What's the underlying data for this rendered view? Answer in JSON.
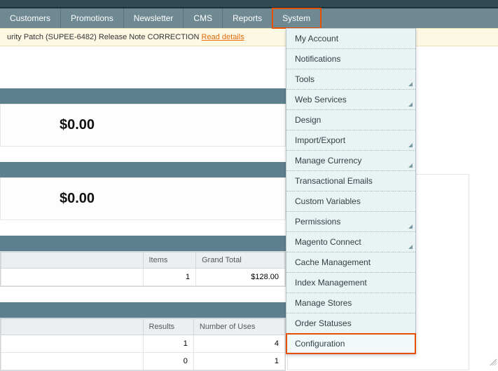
{
  "menubar": {
    "items": [
      {
        "label": "Customers"
      },
      {
        "label": "Promotions"
      },
      {
        "label": "Newsletter"
      },
      {
        "label": "CMS"
      },
      {
        "label": "Reports"
      },
      {
        "label": "System"
      }
    ]
  },
  "notice": {
    "text": "urity Patch (SUPEE-6482) Release Note CORRECTION ",
    "link": "Read details"
  },
  "dashboard": {
    "value_a": "$0.00",
    "value_b": "$0.00",
    "table1": {
      "headers": {
        "blank": "",
        "items": "Items",
        "grand_total": "Grand Total"
      },
      "row": {
        "blank": "",
        "items": "1",
        "grand_total": "$128.00"
      }
    },
    "table2": {
      "headers": {
        "blank": "",
        "results": "Results",
        "uses": "Number of Uses"
      },
      "rows": [
        {
          "blank": "",
          "results": "1",
          "uses": "4"
        },
        {
          "blank": "",
          "results": "0",
          "uses": "1"
        }
      ]
    }
  },
  "system_menu": {
    "items": [
      {
        "label": "My Account",
        "sub": false
      },
      {
        "label": "Notifications",
        "sub": false
      },
      {
        "label": "Tools",
        "sub": true
      },
      {
        "label": "Web Services",
        "sub": true
      },
      {
        "label": "Design",
        "sub": false
      },
      {
        "label": "Import/Export",
        "sub": true
      },
      {
        "label": "Manage Currency",
        "sub": true
      },
      {
        "label": "Transactional Emails",
        "sub": false
      },
      {
        "label": "Custom Variables",
        "sub": false
      },
      {
        "label": "Permissions",
        "sub": true
      },
      {
        "label": "Magento Connect",
        "sub": true
      },
      {
        "label": "Cache Management",
        "sub": false
      },
      {
        "label": "Index Management",
        "sub": false
      },
      {
        "label": "Manage Stores",
        "sub": false
      },
      {
        "label": "Order Statuses",
        "sub": false
      },
      {
        "label": "Configuration",
        "sub": false
      }
    ]
  }
}
